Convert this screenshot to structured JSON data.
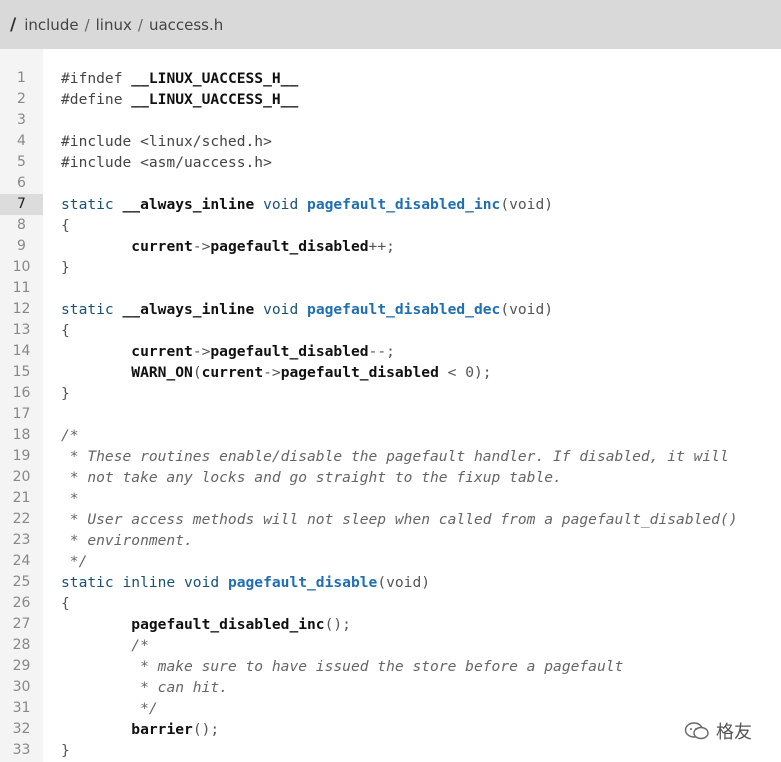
{
  "breadcrumb": {
    "root": "/",
    "parts": [
      "include",
      "linux",
      "uaccess.h"
    ],
    "separator": "/"
  },
  "watermark": "格友",
  "active_line": 7,
  "lines": [
    {
      "n": "1",
      "tokens": [
        [
          "pp",
          "#ifndef "
        ],
        [
          "id",
          "__LINUX_UACCESS_H__"
        ]
      ]
    },
    {
      "n": "2",
      "tokens": [
        [
          "pp",
          "#define "
        ],
        [
          "id",
          "__LINUX_UACCESS_H__"
        ]
      ]
    },
    {
      "n": "3",
      "tokens": []
    },
    {
      "n": "4",
      "tokens": [
        [
          "pp",
          "#include <linux/sched.h>"
        ]
      ]
    },
    {
      "n": "5",
      "tokens": [
        [
          "pp",
          "#include <asm/uaccess.h>"
        ]
      ]
    },
    {
      "n": "6",
      "tokens": []
    },
    {
      "n": "7",
      "tokens": [
        [
          "kw",
          "static "
        ],
        [
          "id",
          "__always_inline"
        ],
        [
          "kw",
          " void "
        ],
        [
          "fn",
          "pagefault_disabled_inc"
        ],
        [
          "op",
          "(void)"
        ]
      ]
    },
    {
      "n": "8",
      "tokens": [
        [
          "op",
          "{"
        ]
      ]
    },
    {
      "n": "9",
      "tokens": [
        [
          "op",
          "        "
        ],
        [
          "id",
          "current"
        ],
        [
          "op",
          "->"
        ],
        [
          "id",
          "pagefault_disabled"
        ],
        [
          "op",
          "++;"
        ]
      ]
    },
    {
      "n": "10",
      "tokens": [
        [
          "op",
          "}"
        ]
      ]
    },
    {
      "n": "11",
      "tokens": []
    },
    {
      "n": "12",
      "tokens": [
        [
          "kw",
          "static "
        ],
        [
          "id",
          "__always_inline"
        ],
        [
          "kw",
          " void "
        ],
        [
          "fn",
          "pagefault_disabled_dec"
        ],
        [
          "op",
          "(void)"
        ]
      ]
    },
    {
      "n": "13",
      "tokens": [
        [
          "op",
          "{"
        ]
      ]
    },
    {
      "n": "14",
      "tokens": [
        [
          "op",
          "        "
        ],
        [
          "id",
          "current"
        ],
        [
          "op",
          "->"
        ],
        [
          "id",
          "pagefault_disabled"
        ],
        [
          "op",
          "--;"
        ]
      ]
    },
    {
      "n": "15",
      "tokens": [
        [
          "op",
          "        "
        ],
        [
          "id",
          "WARN_ON"
        ],
        [
          "op",
          "("
        ],
        [
          "id",
          "current"
        ],
        [
          "op",
          "->"
        ],
        [
          "id",
          "pagefault_disabled"
        ],
        [
          "op",
          " < 0);"
        ]
      ]
    },
    {
      "n": "16",
      "tokens": [
        [
          "op",
          "}"
        ]
      ]
    },
    {
      "n": "17",
      "tokens": []
    },
    {
      "n": "18",
      "tokens": [
        [
          "cm",
          "/*"
        ]
      ]
    },
    {
      "n": "19",
      "tokens": [
        [
          "cm",
          " * These routines enable/disable the pagefault handler. If disabled, it will"
        ]
      ]
    },
    {
      "n": "20",
      "tokens": [
        [
          "cm",
          " * not take any locks and go straight to the fixup table."
        ]
      ]
    },
    {
      "n": "21",
      "tokens": [
        [
          "cm",
          " *"
        ]
      ]
    },
    {
      "n": "22",
      "tokens": [
        [
          "cm",
          " * User access methods will not sleep when called from a pagefault_disabled()"
        ]
      ]
    },
    {
      "n": "23",
      "tokens": [
        [
          "cm",
          " * environment."
        ]
      ]
    },
    {
      "n": "24",
      "tokens": [
        [
          "cm",
          " */"
        ]
      ]
    },
    {
      "n": "25",
      "tokens": [
        [
          "kw",
          "static inline void "
        ],
        [
          "fn",
          "pagefault_disable"
        ],
        [
          "op",
          "(void)"
        ]
      ]
    },
    {
      "n": "26",
      "tokens": [
        [
          "op",
          "{"
        ]
      ]
    },
    {
      "n": "27",
      "tokens": [
        [
          "op",
          "        "
        ],
        [
          "id",
          "pagefault_disabled_inc"
        ],
        [
          "op",
          "();"
        ]
      ]
    },
    {
      "n": "28",
      "tokens": [
        [
          "op",
          "        "
        ],
        [
          "cm",
          "/*"
        ]
      ]
    },
    {
      "n": "29",
      "tokens": [
        [
          "op",
          "        "
        ],
        [
          "cm",
          " * make sure to have issued the store before a pagefault"
        ]
      ]
    },
    {
      "n": "30",
      "tokens": [
        [
          "op",
          "        "
        ],
        [
          "cm",
          " * can hit."
        ]
      ]
    },
    {
      "n": "31",
      "tokens": [
        [
          "op",
          "        "
        ],
        [
          "cm",
          " */"
        ]
      ]
    },
    {
      "n": "32",
      "tokens": [
        [
          "op",
          "        "
        ],
        [
          "id",
          "barrier"
        ],
        [
          "op",
          "();"
        ]
      ]
    },
    {
      "n": "33",
      "tokens": [
        [
          "op",
          "}"
        ]
      ]
    }
  ]
}
